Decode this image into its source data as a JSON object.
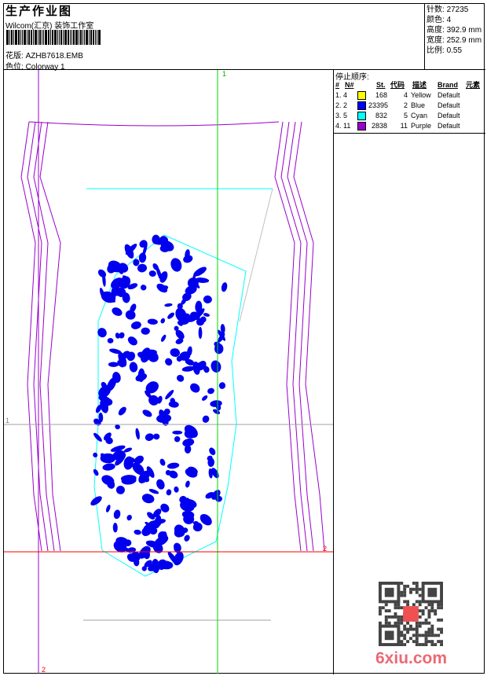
{
  "header": {
    "title": "生产作业图",
    "company": "Wilcom(汇京) 装饰工作室",
    "design_label": "花版:",
    "design_value": "AZHB7618.EMB",
    "colorway_label": "色位:",
    "colorway_value": "Colorway 1"
  },
  "info": {
    "stitches_label": "针数:",
    "stitches": "27235",
    "colors_label": "颜色:",
    "colors": "4",
    "height_label": "高度:",
    "height": "392.9 mm",
    "width_label": "宽度:",
    "width": "252.9 mm",
    "scale_label": "比例:",
    "scale": "0.55"
  },
  "stop_sequence": {
    "caption": "停止顺序:",
    "headers": [
      "#",
      "N#",
      "St.",
      "代码",
      "描述",
      "Brand",
      "元素"
    ],
    "rows": [
      {
        "idx": "1.",
        "n": "4",
        "color": "#ffff00",
        "st": "168",
        "code": "4",
        "desc": "Yellow",
        "brand": "Default"
      },
      {
        "idx": "2.",
        "n": "2",
        "color": "#0000ff",
        "st": "23395",
        "code": "2",
        "desc": "Blue",
        "brand": "Default"
      },
      {
        "idx": "3.",
        "n": "5",
        "color": "#00ffff",
        "st": "832",
        "code": "5",
        "desc": "Cyan",
        "brand": "Default"
      },
      {
        "idx": "4.",
        "n": "11",
        "color": "#9900cc",
        "st": "2838",
        "code": "11",
        "desc": "Purple",
        "brand": "Default"
      }
    ]
  },
  "guides": {
    "green_label": "1",
    "gray_label": "1",
    "red_label": "2",
    "purple_label": "2"
  },
  "watermark": "6xiu.com"
}
